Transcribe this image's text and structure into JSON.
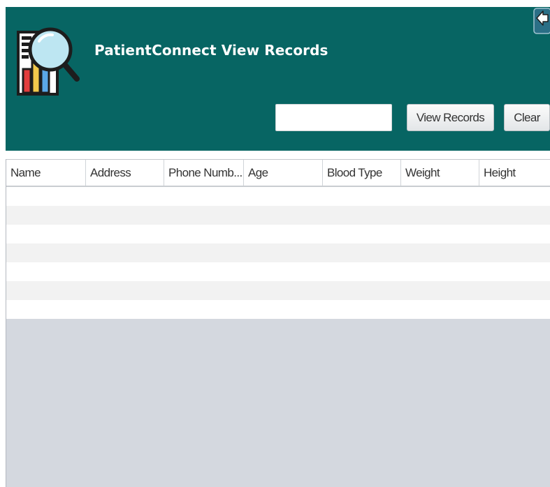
{
  "app": {
    "title": "PatientConnect View Records"
  },
  "search": {
    "value": "",
    "placeholder": ""
  },
  "buttons": {
    "view_records": "View Records",
    "clear": "Clear"
  },
  "table": {
    "columns": [
      "Name",
      "Address",
      "Phone Numb...",
      "Age",
      "Blood Type",
      "Weight",
      "Height"
    ],
    "rows": []
  },
  "colors": {
    "header_bg": "#076563",
    "table_empty_bg": "#d4d8df",
    "row_alt": "#f2f2f2"
  },
  "icons": {
    "logo": "records-search-icon",
    "back": "back-arrow-icon"
  }
}
